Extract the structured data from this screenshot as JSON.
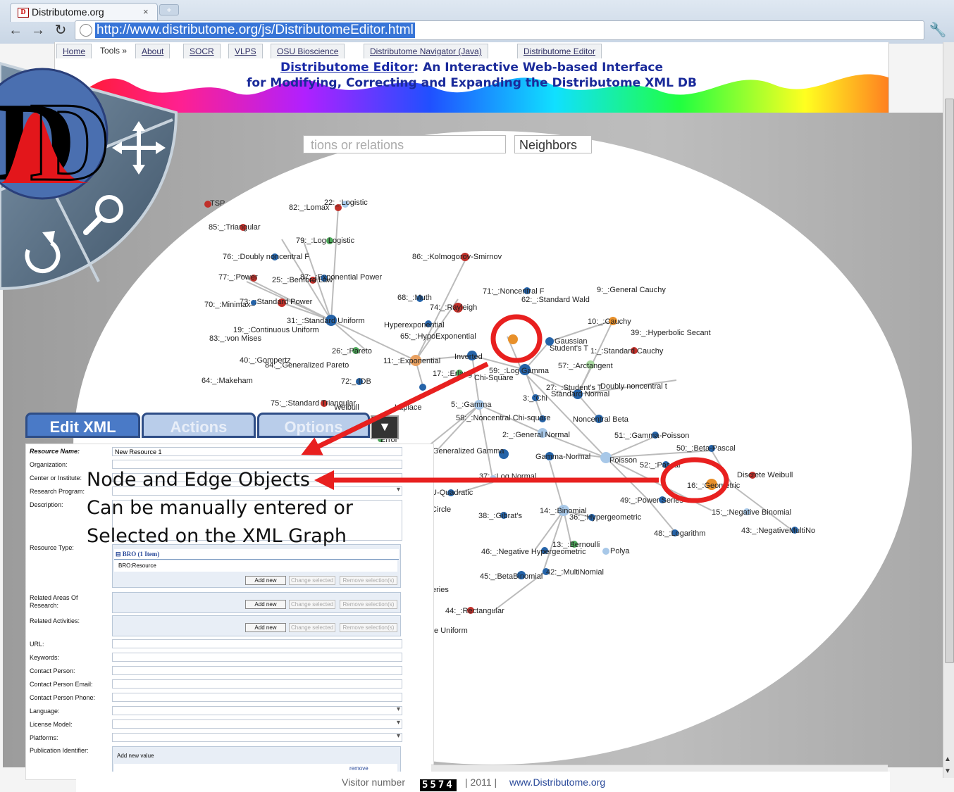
{
  "browser": {
    "tab_title": "Distributome.org",
    "tab_favicon": "D",
    "tab_close": "×",
    "new_tab": "+",
    "url": "http://www.distributome.org/js/DistributomeEditor.html"
  },
  "site_nav": {
    "items": [
      "Home",
      "About",
      "SOCR",
      "VLPS",
      "OSU Bioscience",
      "Distributome Navigator (Java)",
      "Distributome Editor"
    ],
    "tools_label": "Tools »"
  },
  "header": {
    "title_link": "Distributome Editor",
    "title_rest": ": An Interactive Web-based Interface",
    "subtitle": "for Modifying, Correcting and Expanding the Distributome XML DB"
  },
  "toolbar": {
    "search_placeholder": "tions or relations",
    "neighbors_label": "Neighbors"
  },
  "panel": {
    "tabs": [
      "Edit XML",
      "Actions",
      "Options"
    ],
    "toggle_icon": "chevron-down-icon"
  },
  "form": {
    "resource_name_label": "Resource Name:",
    "resource_name_value": "New Resource 1",
    "labels": {
      "organization": "Organization:",
      "center": "Center or Institute:",
      "program": "Research Program:",
      "description": "Description:",
      "resource_type": "Resource Type:",
      "related_areas": "Related Areas Of",
      "related_areas_2": "Research:",
      "related_activities": "Related Activities:",
      "url": "URL:",
      "keywords": "Keywords:",
      "contact_person": "Contact Person:",
      "contact_email": "Contact Person Email:",
      "contact_phone": "Contact Person Phone:",
      "language": "Language:",
      "license": "License Model:",
      "platforms": "Platforms:",
      "publication": "Publication Identifier:"
    },
    "bro_header": "BRO (1 Item)",
    "bro_item": "BRO:Resource",
    "add_new": "Add new",
    "change_selected": "Change selected",
    "remove_selection": "Remove selection(s)",
    "add_new_value": "Add new value",
    "remove": "remove"
  },
  "callout": {
    "line1": "Node and Edge Objects",
    "line2": "Can be manually entered or",
    "line3": "Selected on the XML Graph"
  },
  "graph_labels": [
    "TSP",
    "82:_:Lomax",
    "22:_:Logistic",
    "85:_:Triangular",
    "79:_:Log Logistic",
    "76:_:Doubly noncentral F",
    "86:_:Kolmogorov-Smirnov",
    "77:_:Power",
    "25:_:Benford Law",
    "87:_:Exponential Power",
    "9:_:General Cauchy",
    "71:_:Noncentral F",
    "62:_:Standard Wald",
    "70:_:Minimax",
    "73:_:Standard Power",
    "68:_:Muth",
    "74:_:Rayleigh",
    "10:_:Cauchy",
    "31:_:Standard Uniform",
    "Hyperexponential",
    "39:_:Hyperbolic Secant",
    "19:_:Continuous Uniform",
    "65:_:HypoExponential",
    "Gaussian",
    "83:_:von Mises",
    "Student's T",
    "1:_:Standard Cauchy",
    "26:_:Pareto",
    "40:_:Gompertz",
    "84:_:Generalized Pareto",
    "11:_:Exponential",
    "Inverted",
    "57:_:Arctangent",
    "64:_:Makeham",
    "72:_:IDB",
    "17:_:Erlang",
    "59:_:Log Gamma",
    "Chi-Square",
    "27:_:Student's T",
    "Doubly noncentral t",
    "Standard Normal",
    "3:_:Chi",
    "75:_:Standard Triangular",
    "Weibull",
    "Laplace",
    "5:_:Gamma",
    "58:_:Noncentral Chi-square",
    "Noncentral Beta",
    "2:_:General Normal",
    "51:_:Gamma-Poisson",
    "Error",
    "Generalized Gamma",
    "Gamma-Normal",
    "Poisson",
    "50:_:Beta-Pascal",
    "52:_:Pascal",
    "Discrete Weibull",
    "16:_:Geometric",
    "37:_:Log Normal",
    "U-Quadratic",
    "49:_:Power Series",
    "Circle",
    "14:_:Binomial",
    "15:_:Negative Binomial",
    "38:_:Gibrat's",
    "36:_:Hypergeometric",
    "48:_:Logarithm",
    "43:_:NegativeMultiNo",
    "13:_:Bernoulli",
    "46:_:Negative Hypergeometric",
    "Polya",
    "42:_:MultiNomial",
    "45:_:BetaBinomial",
    "eries",
    "44:_:Rectangular",
    "te Uniform"
  ],
  "footer": {
    "visitor_label": "Visitor number",
    "visitor_count": "5574",
    "year": "| 2011 |",
    "site": "www.Distributome.org"
  },
  "colors": {
    "accent": "#3875d7",
    "title": "#1a2a9a",
    "annotation": "#e8201f",
    "panel_tab_active": "#4a7ac7",
    "panel_tab_inactive": "#b9cdea"
  },
  "icons": [
    "move-icon",
    "zoom-icon",
    "rotate-icon",
    "logo-icon",
    "wrench-icon",
    "globe-icon"
  ]
}
